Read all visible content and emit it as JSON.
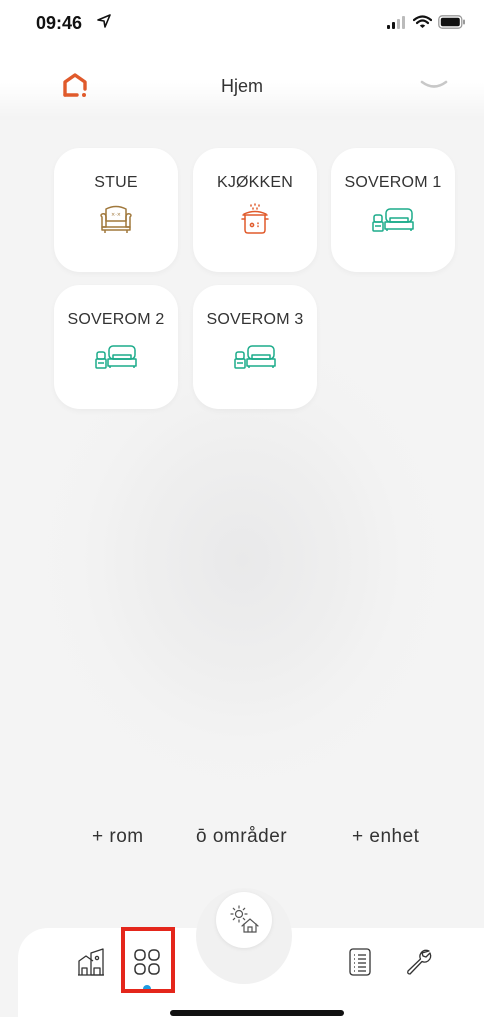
{
  "status_bar": {
    "time": "09:46",
    "icons": [
      "location-arrow-icon",
      "signal-icon",
      "wifi-icon",
      "battery-icon"
    ]
  },
  "header": {
    "title": "Hjem",
    "logo_icon": "home-logo-icon",
    "chevron_icon": "chevron-down-icon"
  },
  "rooms": [
    {
      "label": "STUE",
      "icon": "armchair-icon",
      "color": "#a0783c"
    },
    {
      "label": "KJØKKEN",
      "icon": "cooking-pot-icon",
      "color": "#e05a2b"
    },
    {
      "label": "SOVEROM 1",
      "icon": "bed-icon",
      "color": "#1bab8a"
    },
    {
      "label": "SOVEROM 2",
      "icon": "bed-icon",
      "color": "#1bab8a"
    },
    {
      "label": "SOVEROM 3",
      "icon": "bed-icon",
      "color": "#1bab8a"
    }
  ],
  "bottom_links": {
    "add_room": "+ rom",
    "areas": "ō områder",
    "add_device": "+ enhet"
  },
  "tabbar": {
    "tabs": [
      "house-icon",
      "rooms-grid-icon",
      "weather-home-icon",
      "list-icon",
      "wrench-icon"
    ],
    "active_tab": "rooms-grid-icon"
  },
  "colors": {
    "accent": "#1f9be0",
    "logo": "#e05a2b",
    "highlight": "#e4261b"
  }
}
